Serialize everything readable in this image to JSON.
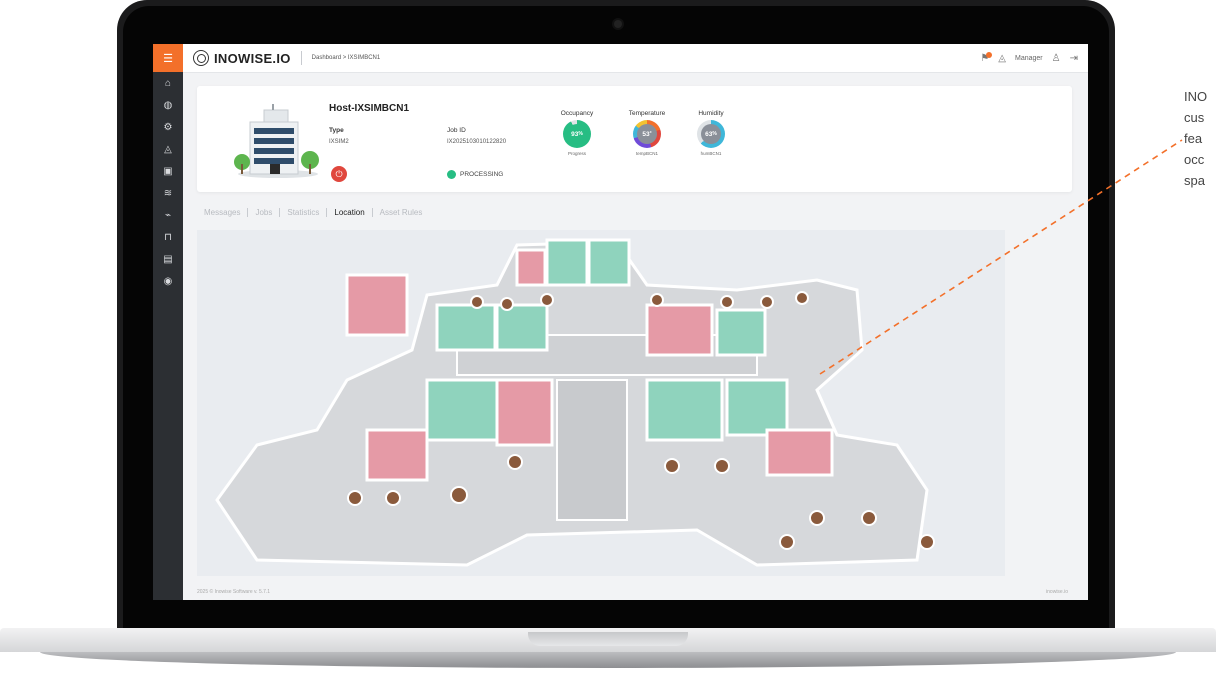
{
  "app": {
    "logo_text": "INOWISE.IO",
    "breadcrumb": "Dashboard > IXSIMBCN1",
    "user_label": "Manager"
  },
  "sidebar": {
    "icons": [
      "menu-icon",
      "home-icon",
      "globe-icon",
      "settings-icon",
      "bell-icon",
      "inbox-icon",
      "wifi-icon",
      "activity-icon",
      "lock-icon",
      "building-icon",
      "location-pin-icon"
    ]
  },
  "host": {
    "title": "Host-IXSIMBCN1",
    "type_label": "Type",
    "type_value": "IXSIM2",
    "job_label": "Job ID",
    "job_value": "IX20251030101228​20",
    "status": "PROCESSING"
  },
  "gauges": [
    {
      "title": "Occupancy",
      "value": "93",
      "unit": "%",
      "caption": "Progress",
      "color": "#27bd83"
    },
    {
      "title": "Temperature",
      "value": "53",
      "unit": "°",
      "caption": "tempBCN1",
      "color": "#8a8f98"
    },
    {
      "title": "Humidity",
      "value": "63",
      "unit": "%",
      "caption": "humBCN1",
      "color": "#8a8f98"
    }
  ],
  "tabs": [
    "Messages",
    "Jobs",
    "Statistics",
    "Location",
    "Asset Rules"
  ],
  "active_tab": "Location",
  "footer": {
    "copyright": "2025 © Inowise Software v. 5.7.1",
    "right": "inowise.io"
  },
  "side_text": [
    "INO",
    "cus",
    "fea",
    "occ",
    "spa"
  ],
  "colors": {
    "accent": "#f3702a",
    "occupied_room": "#e59aa6",
    "free_room": "#8fd3bd",
    "sidebar": "#2c2f33"
  }
}
